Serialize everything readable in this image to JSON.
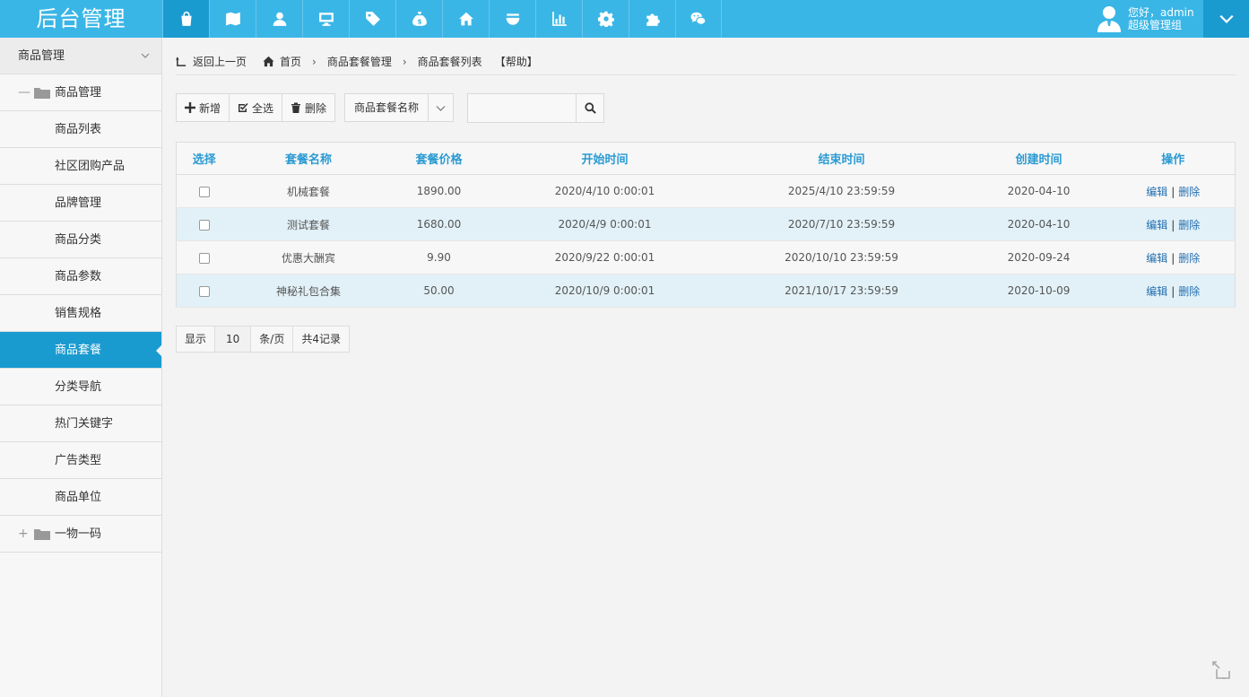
{
  "header": {
    "brand": "后台管理",
    "nav_icons": [
      "bag-icon",
      "map-icon",
      "user-icon",
      "monitor-icon",
      "tag-icon",
      "moneybag-icon",
      "home-icon",
      "bowl-icon",
      "bar-chart-icon",
      "gear-icon",
      "puzzle-icon",
      "wechat-icon"
    ],
    "greeting": "您好，admin",
    "role": "超级管理组"
  },
  "sidebar": {
    "section_title": "商品管理",
    "folder1": {
      "toggle": "—",
      "label": "商品管理"
    },
    "items": [
      {
        "label": "商品列表"
      },
      {
        "label": "社区团购产品"
      },
      {
        "label": "品牌管理"
      },
      {
        "label": "商品分类"
      },
      {
        "label": "商品参数"
      },
      {
        "label": "销售规格"
      },
      {
        "label": "商品套餐",
        "active": true
      },
      {
        "label": "分类导航"
      },
      {
        "label": "热门关键字"
      },
      {
        "label": "广告类型"
      },
      {
        "label": "商品单位"
      }
    ],
    "folder2": {
      "toggle": "+",
      "label": "一物一码"
    }
  },
  "breadcrumb": {
    "back": "返回上一页",
    "home": "首页",
    "level1": "商品套餐管理",
    "level2": "商品套餐列表",
    "help": "【帮助】"
  },
  "toolbar": {
    "add": "新增",
    "select_all": "全选",
    "delete": "删除",
    "field_select": "商品套餐名称",
    "search_placeholder": ""
  },
  "table": {
    "headers": [
      "选择",
      "套餐名称",
      "套餐价格",
      "开始时间",
      "结束时间",
      "创建时间",
      "操作"
    ],
    "rows": [
      {
        "name": "机械套餐",
        "price": "1890.00",
        "start": "2020/4/10 0:00:01",
        "end": "2025/4/10 23:59:59",
        "created": "2020-04-10"
      },
      {
        "name": "测试套餐",
        "price": "1680.00",
        "start": "2020/4/9 0:00:01",
        "end": "2020/7/10 23:59:59",
        "created": "2020-04-10"
      },
      {
        "name": "优惠大酬宾",
        "price": "9.90",
        "start": "2020/9/22 0:00:01",
        "end": "2020/10/10 23:59:59",
        "created": "2020-09-24"
      },
      {
        "name": "神秘礼包合集",
        "price": "50.00",
        "start": "2020/10/9 0:00:01",
        "end": "2021/10/17 23:59:59",
        "created": "2020-10-09"
      }
    ],
    "edit_label": "编辑",
    "divider": "|",
    "delete_label": "删除"
  },
  "pager": {
    "show": "显示",
    "per_page": "10",
    "unit": "条/页",
    "total": "共4记录"
  },
  "colors": {
    "topbar": "#3ab6e6",
    "active": "#1a9bd0",
    "header_text": "#2b9ad2",
    "link": "#2470b0",
    "alt_row": "#e2f1f8"
  }
}
